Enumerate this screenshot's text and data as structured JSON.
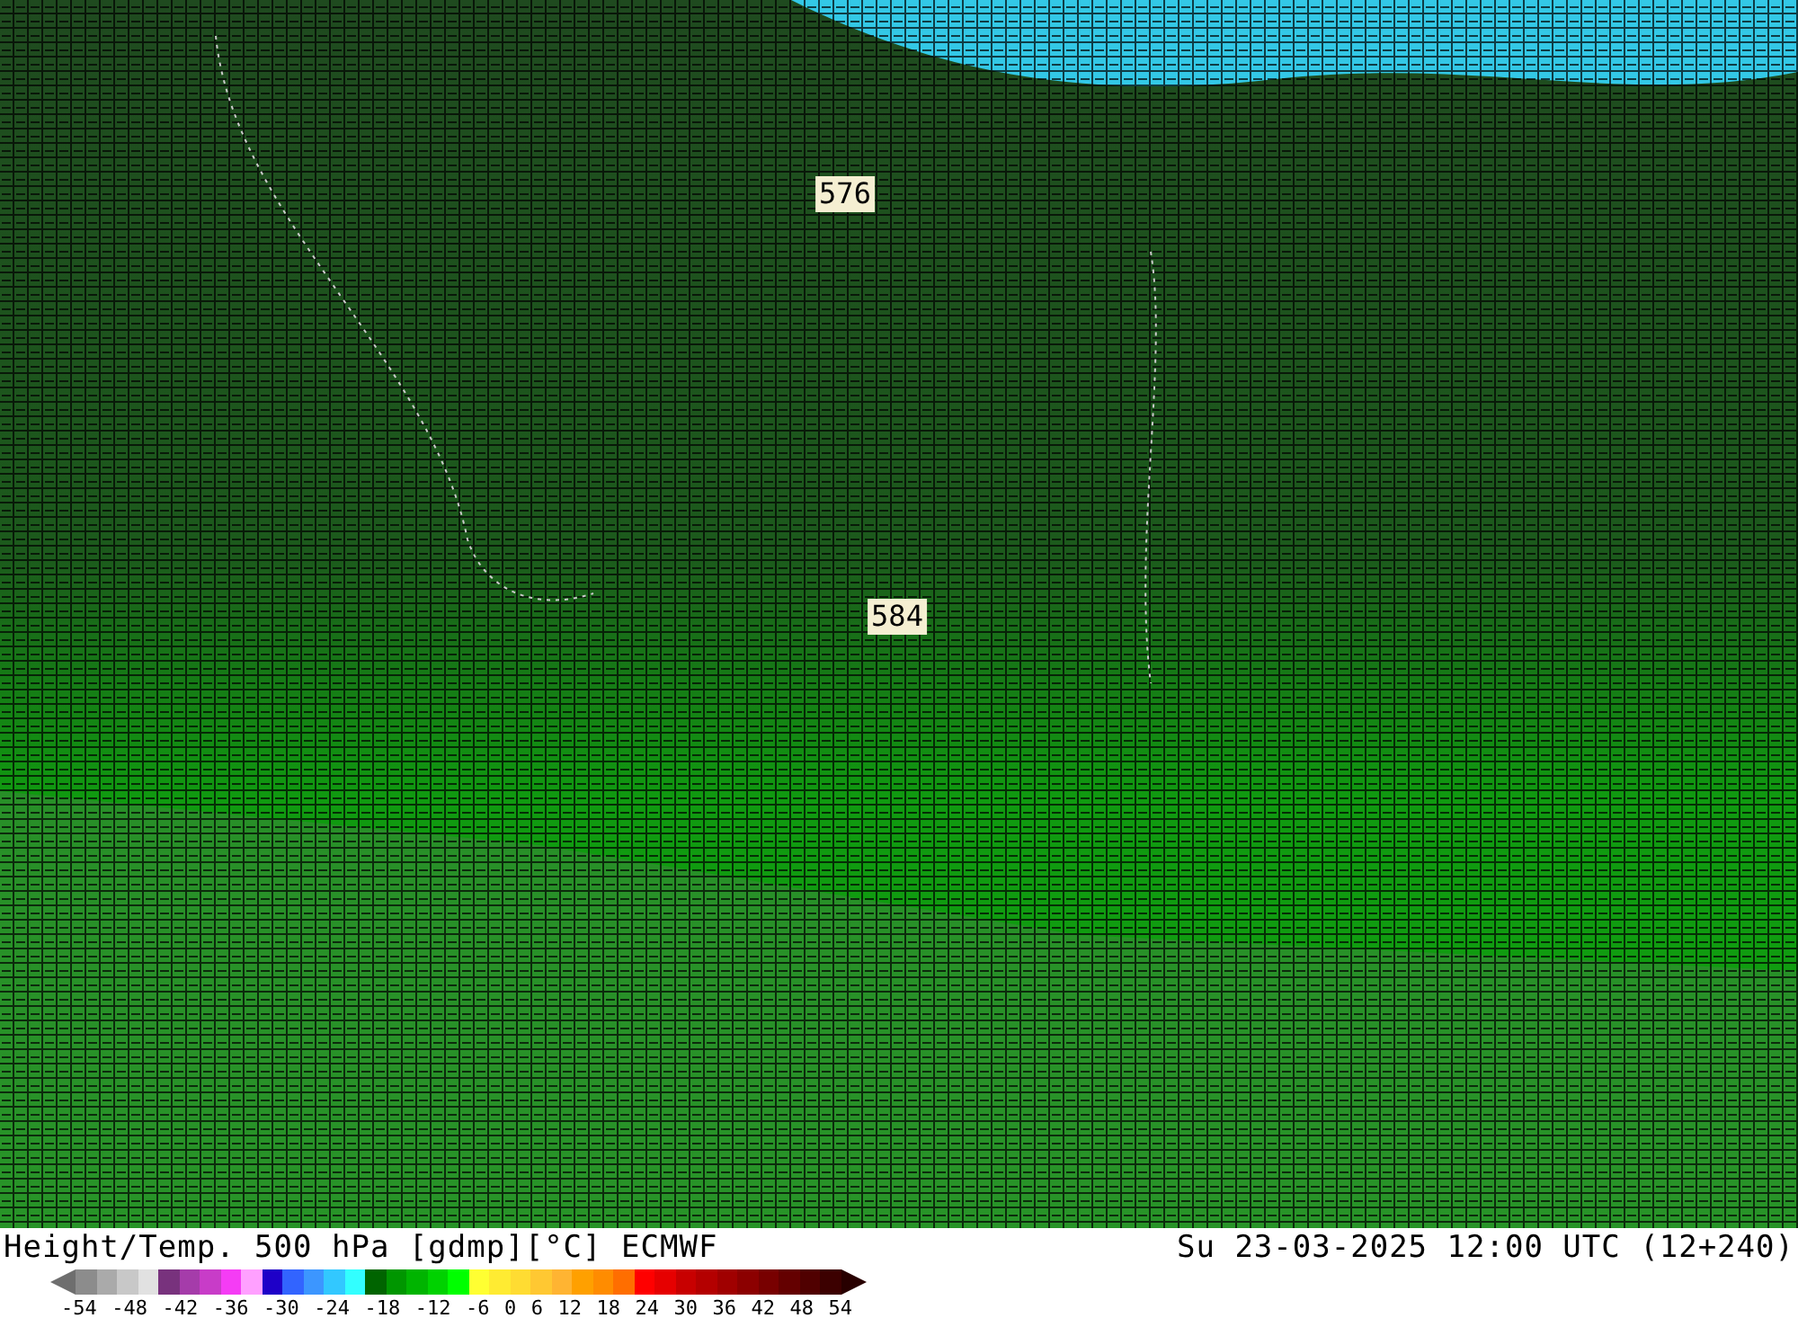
{
  "map": {
    "contour_labels": [
      {
        "text": "576"
      },
      {
        "text": "584"
      }
    ]
  },
  "footer": {
    "title": "Height/Temp. 500 hPa [gdmp][°C] ECMWF",
    "datetime": "Su 23-03-2025 12:00 UTC (12+240)"
  },
  "legend": {
    "swatches": [
      {
        "color": "#8c8c8c"
      },
      {
        "color": "#aaaaaa"
      },
      {
        "color": "#c8c8c8"
      },
      {
        "color": "#e1e1e1"
      },
      {
        "color": "#78327d"
      },
      {
        "color": "#a53caa"
      },
      {
        "color": "#c83cc8"
      },
      {
        "color": "#f53cf5"
      },
      {
        "color": "#ffa0ff"
      },
      {
        "color": "#1e00c8"
      },
      {
        "color": "#3264ff"
      },
      {
        "color": "#3c96ff"
      },
      {
        "color": "#32c8ff"
      },
      {
        "color": "#32ffff"
      },
      {
        "color": "#006400"
      },
      {
        "color": "#009600"
      },
      {
        "color": "#00b400"
      },
      {
        "color": "#00d200"
      },
      {
        "color": "#00ff00"
      },
      {
        "color": "#ffff32"
      },
      {
        "color": "#ffeb32"
      },
      {
        "color": "#ffdc32"
      },
      {
        "color": "#ffc832"
      },
      {
        "color": "#ffb432"
      },
      {
        "color": "#ffa000"
      },
      {
        "color": "#ff8c00"
      },
      {
        "color": "#ff6e00"
      },
      {
        "color": "#ff0000"
      },
      {
        "color": "#e60000"
      },
      {
        "color": "#c80000"
      },
      {
        "color": "#b40000"
      },
      {
        "color": "#a00000"
      },
      {
        "color": "#8c0000"
      },
      {
        "color": "#780000"
      },
      {
        "color": "#640000"
      },
      {
        "color": "#500000"
      },
      {
        "color": "#3c0000"
      }
    ],
    "ticks": [
      "-54",
      "-48",
      "-42",
      "-36",
      "-30",
      "-24",
      "-18",
      "-12",
      "-6",
      "0",
      "6",
      "12",
      "18",
      "24",
      "30",
      "36",
      "42",
      "48",
      "54"
    ]
  }
}
